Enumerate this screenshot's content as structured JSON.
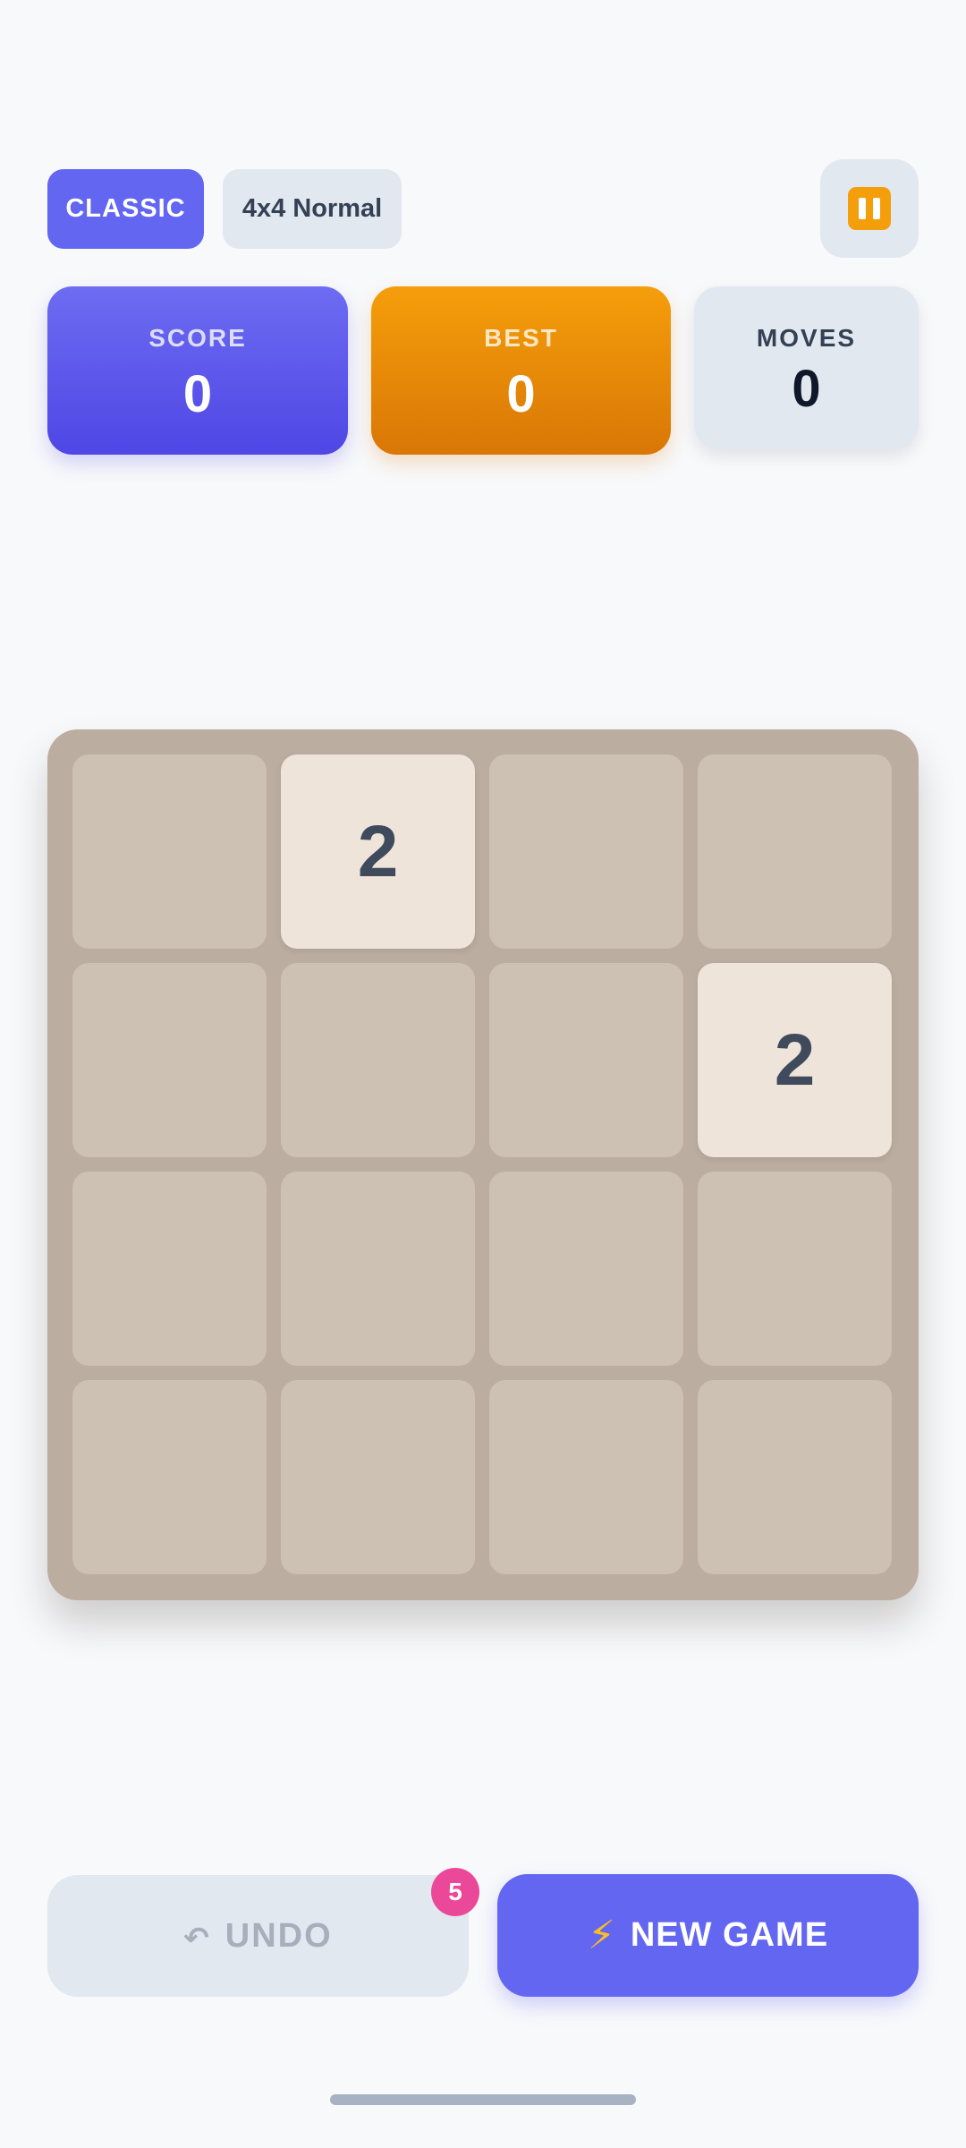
{
  "header": {
    "mode_label": "CLASSIC",
    "size_label": "4x4 Normal",
    "pause_icon": "pause-icon"
  },
  "stats": {
    "score": {
      "label": "SCORE",
      "value": "0"
    },
    "best": {
      "label": "BEST",
      "value": "0"
    },
    "moves": {
      "label": "MOVES",
      "value": "0"
    }
  },
  "board": {
    "size": 4,
    "tiles": [
      [
        "",
        "2",
        "",
        ""
      ],
      [
        "",
        "",
        "",
        "2"
      ],
      [
        "",
        "",
        "",
        ""
      ],
      [
        "",
        "",
        "",
        ""
      ]
    ]
  },
  "actions": {
    "undo": {
      "icon": "↶",
      "label": "UNDO",
      "badge": "5"
    },
    "new_game": {
      "icon": "⚡",
      "label": "NEW GAME"
    }
  },
  "colors": {
    "accent": "#6366f1",
    "best": "#f59e0b",
    "board": "#bbada0",
    "empty_cell": "#cdc1b4",
    "tile_2": "#eee4da",
    "badge": "#ec4899"
  }
}
